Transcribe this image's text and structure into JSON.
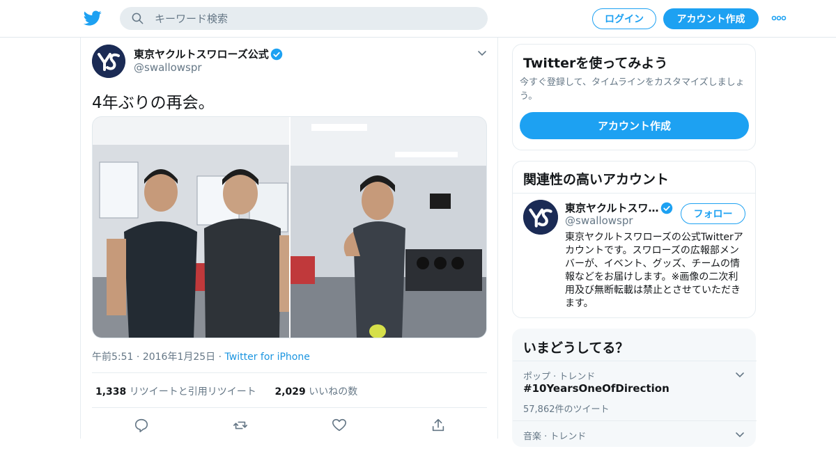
{
  "header": {
    "search_placeholder": "キーワード検索",
    "login_label": "ログイン",
    "signup_label": "アカウント作成"
  },
  "tweet": {
    "author_name": "東京ヤクルトスワローズ公式",
    "author_handle": "@swallowspr",
    "text": "4年ぶりの再会。",
    "time": "午前5:51",
    "date": "2016年1月25日",
    "source": "Twitter for iPhone",
    "retweets_count": "1,338",
    "retweets_label": "リツイートと引用リツイート",
    "likes_count": "2,029",
    "likes_label": "いいねの数"
  },
  "sidebar": {
    "signup_card": {
      "title": "Twitterを使ってみよう",
      "subtitle": "今すぐ登録して、タイムラインをカスタマイズしましょう。",
      "button": "アカウント作成"
    },
    "relevant": {
      "title": "関連性の高いアカウント",
      "name": "東京ヤクルトスワ…",
      "handle": "@swallowspr",
      "follow_label": "フォロー",
      "bio": "東京ヤクルトスワローズの公式Twitterアカウントです。スワローズの広報部メンバーが、イベント、グッズ、チームの情報などをお届けします。※画像の二次利用及び無断転載は禁止とさせていただきます。"
    },
    "trends": {
      "title": "いまどうしてる？",
      "items": [
        {
          "category": "ポップ · トレンド",
          "name": "#10YearsOneOfDirection",
          "count": "57,862件のツイート"
        },
        {
          "category": "音楽 · トレンド",
          "name": "",
          "count": ""
        }
      ]
    }
  },
  "colors": {
    "brand_blue": "#1da1f2",
    "link_blue": "#1b95e0",
    "secondary_text": "#657786",
    "border": "#e6ecf0"
  }
}
